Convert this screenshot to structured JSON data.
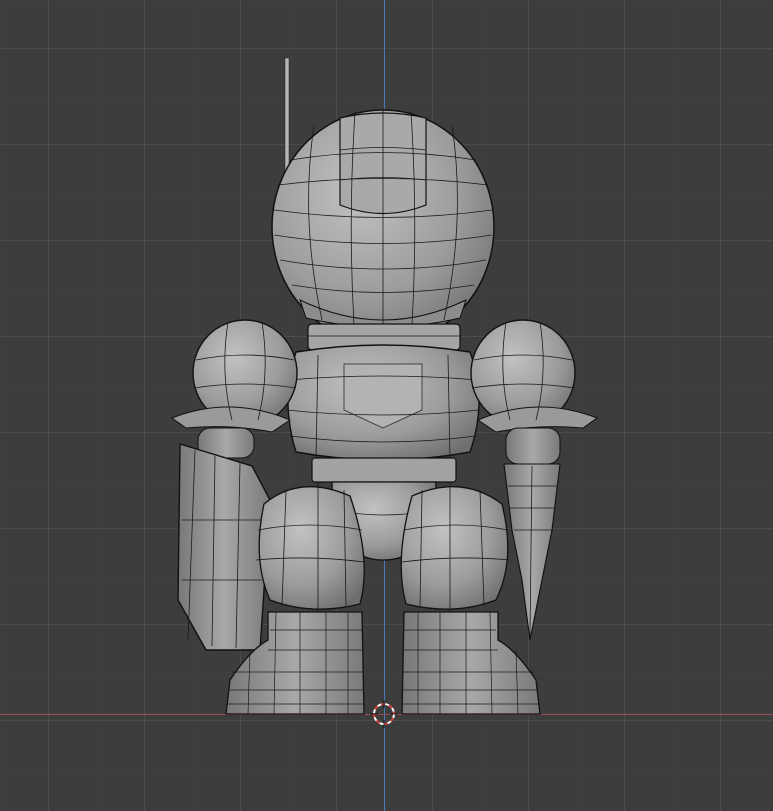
{
  "viewport": {
    "background_color": "#3d3d3d",
    "axis_x_color": "#9a4e52",
    "axis_y_color": "#4c78b8",
    "grid_minor_color": "rgba(255,255,255,0.07)"
  },
  "scene": {
    "object_icon": "robot-mesh",
    "mesh_fill": "#9a9a9a",
    "wire_color": "#1a1a1a",
    "cursor_icon": "3d-cursor"
  }
}
